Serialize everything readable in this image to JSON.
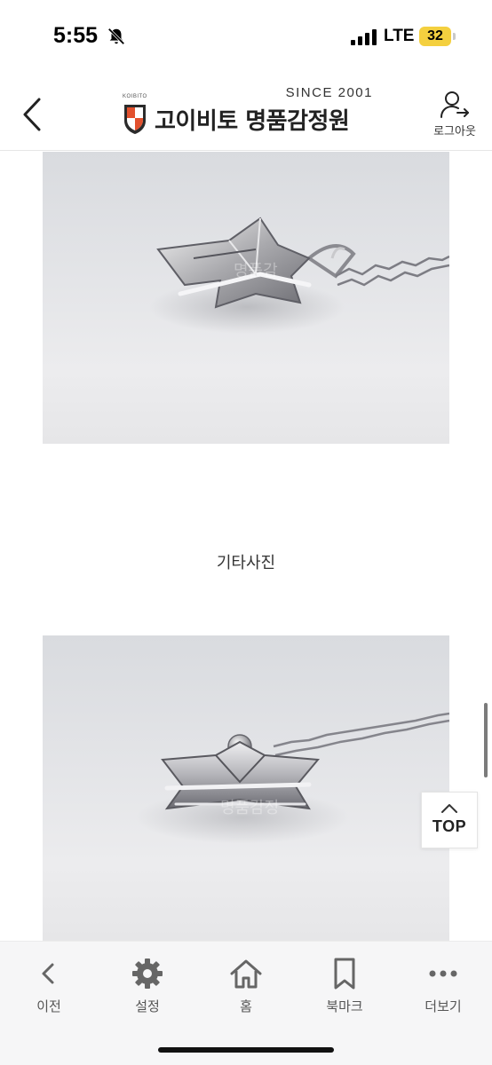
{
  "status_bar": {
    "time": "5:55",
    "network": "LTE",
    "battery": "32",
    "icons": [
      "bell-slash-icon",
      "signal-bars-icon"
    ]
  },
  "header": {
    "brand_since": "SINCE 2001",
    "brand_name": "고이비토 명품감정원",
    "brand_mark": "KOIBITO",
    "logout_label": "로그아웃",
    "colors": {
      "shield_red": "#e2512e",
      "shield_dark": "#2b2b2b"
    }
  },
  "content": {
    "section_caption": "기타사진",
    "photos": [
      {
        "subject": "silver star pendant on chain",
        "watermark": "고이비토 명품감정원"
      },
      {
        "subject": "silver star pendant on chain",
        "watermark": "고이비토 명품감정원"
      }
    ]
  },
  "top_button": {
    "label": "TOP"
  },
  "bottom_nav": {
    "items": [
      {
        "label": "이전",
        "icon": "chevron-left-icon"
      },
      {
        "label": "설정",
        "icon": "gear-icon"
      },
      {
        "label": "홈",
        "icon": "home-icon"
      },
      {
        "label": "북마크",
        "icon": "bookmark-icon"
      },
      {
        "label": "더보기",
        "icon": "more-dots-icon"
      }
    ]
  }
}
